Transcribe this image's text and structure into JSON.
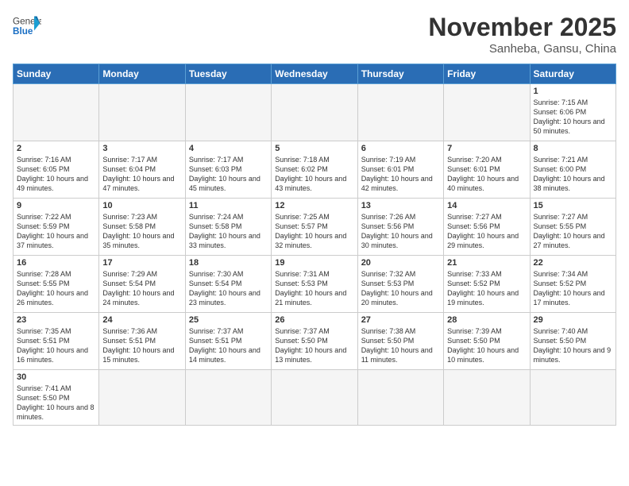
{
  "header": {
    "logo_general": "General",
    "logo_blue": "Blue",
    "month_title": "November 2025",
    "location": "Sanheba, Gansu, China"
  },
  "weekdays": [
    "Sunday",
    "Monday",
    "Tuesday",
    "Wednesday",
    "Thursday",
    "Friday",
    "Saturday"
  ],
  "weeks": [
    [
      {
        "day": "",
        "info": ""
      },
      {
        "day": "",
        "info": ""
      },
      {
        "day": "",
        "info": ""
      },
      {
        "day": "",
        "info": ""
      },
      {
        "day": "",
        "info": ""
      },
      {
        "day": "",
        "info": ""
      },
      {
        "day": "1",
        "info": "Sunrise: 7:15 AM\nSunset: 6:06 PM\nDaylight: 10 hours\nand 50 minutes."
      }
    ],
    [
      {
        "day": "2",
        "info": "Sunrise: 7:16 AM\nSunset: 6:05 PM\nDaylight: 10 hours\nand 49 minutes."
      },
      {
        "day": "3",
        "info": "Sunrise: 7:17 AM\nSunset: 6:04 PM\nDaylight: 10 hours\nand 47 minutes."
      },
      {
        "day": "4",
        "info": "Sunrise: 7:17 AM\nSunset: 6:03 PM\nDaylight: 10 hours\nand 45 minutes."
      },
      {
        "day": "5",
        "info": "Sunrise: 7:18 AM\nSunset: 6:02 PM\nDaylight: 10 hours\nand 43 minutes."
      },
      {
        "day": "6",
        "info": "Sunrise: 7:19 AM\nSunset: 6:01 PM\nDaylight: 10 hours\nand 42 minutes."
      },
      {
        "day": "7",
        "info": "Sunrise: 7:20 AM\nSunset: 6:01 PM\nDaylight: 10 hours\nand 40 minutes."
      },
      {
        "day": "8",
        "info": "Sunrise: 7:21 AM\nSunset: 6:00 PM\nDaylight: 10 hours\nand 38 minutes."
      }
    ],
    [
      {
        "day": "9",
        "info": "Sunrise: 7:22 AM\nSunset: 5:59 PM\nDaylight: 10 hours\nand 37 minutes."
      },
      {
        "day": "10",
        "info": "Sunrise: 7:23 AM\nSunset: 5:58 PM\nDaylight: 10 hours\nand 35 minutes."
      },
      {
        "day": "11",
        "info": "Sunrise: 7:24 AM\nSunset: 5:58 PM\nDaylight: 10 hours\nand 33 minutes."
      },
      {
        "day": "12",
        "info": "Sunrise: 7:25 AM\nSunset: 5:57 PM\nDaylight: 10 hours\nand 32 minutes."
      },
      {
        "day": "13",
        "info": "Sunrise: 7:26 AM\nSunset: 5:56 PM\nDaylight: 10 hours\nand 30 minutes."
      },
      {
        "day": "14",
        "info": "Sunrise: 7:27 AM\nSunset: 5:56 PM\nDaylight: 10 hours\nand 29 minutes."
      },
      {
        "day": "15",
        "info": "Sunrise: 7:27 AM\nSunset: 5:55 PM\nDaylight: 10 hours\nand 27 minutes."
      }
    ],
    [
      {
        "day": "16",
        "info": "Sunrise: 7:28 AM\nSunset: 5:55 PM\nDaylight: 10 hours\nand 26 minutes."
      },
      {
        "day": "17",
        "info": "Sunrise: 7:29 AM\nSunset: 5:54 PM\nDaylight: 10 hours\nand 24 minutes."
      },
      {
        "day": "18",
        "info": "Sunrise: 7:30 AM\nSunset: 5:54 PM\nDaylight: 10 hours\nand 23 minutes."
      },
      {
        "day": "19",
        "info": "Sunrise: 7:31 AM\nSunset: 5:53 PM\nDaylight: 10 hours\nand 21 minutes."
      },
      {
        "day": "20",
        "info": "Sunrise: 7:32 AM\nSunset: 5:53 PM\nDaylight: 10 hours\nand 20 minutes."
      },
      {
        "day": "21",
        "info": "Sunrise: 7:33 AM\nSunset: 5:52 PM\nDaylight: 10 hours\nand 19 minutes."
      },
      {
        "day": "22",
        "info": "Sunrise: 7:34 AM\nSunset: 5:52 PM\nDaylight: 10 hours\nand 17 minutes."
      }
    ],
    [
      {
        "day": "23",
        "info": "Sunrise: 7:35 AM\nSunset: 5:51 PM\nDaylight: 10 hours\nand 16 minutes."
      },
      {
        "day": "24",
        "info": "Sunrise: 7:36 AM\nSunset: 5:51 PM\nDaylight: 10 hours\nand 15 minutes."
      },
      {
        "day": "25",
        "info": "Sunrise: 7:37 AM\nSunset: 5:51 PM\nDaylight: 10 hours\nand 14 minutes."
      },
      {
        "day": "26",
        "info": "Sunrise: 7:37 AM\nSunset: 5:50 PM\nDaylight: 10 hours\nand 13 minutes."
      },
      {
        "day": "27",
        "info": "Sunrise: 7:38 AM\nSunset: 5:50 PM\nDaylight: 10 hours\nand 11 minutes."
      },
      {
        "day": "28",
        "info": "Sunrise: 7:39 AM\nSunset: 5:50 PM\nDaylight: 10 hours\nand 10 minutes."
      },
      {
        "day": "29",
        "info": "Sunrise: 7:40 AM\nSunset: 5:50 PM\nDaylight: 10 hours\nand 9 minutes."
      }
    ],
    [
      {
        "day": "30",
        "info": "Sunrise: 7:41 AM\nSunset: 5:50 PM\nDaylight: 10 hours\nand 8 minutes."
      },
      {
        "day": "",
        "info": ""
      },
      {
        "day": "",
        "info": ""
      },
      {
        "day": "",
        "info": ""
      },
      {
        "day": "",
        "info": ""
      },
      {
        "day": "",
        "info": ""
      },
      {
        "day": "",
        "info": ""
      }
    ]
  ]
}
